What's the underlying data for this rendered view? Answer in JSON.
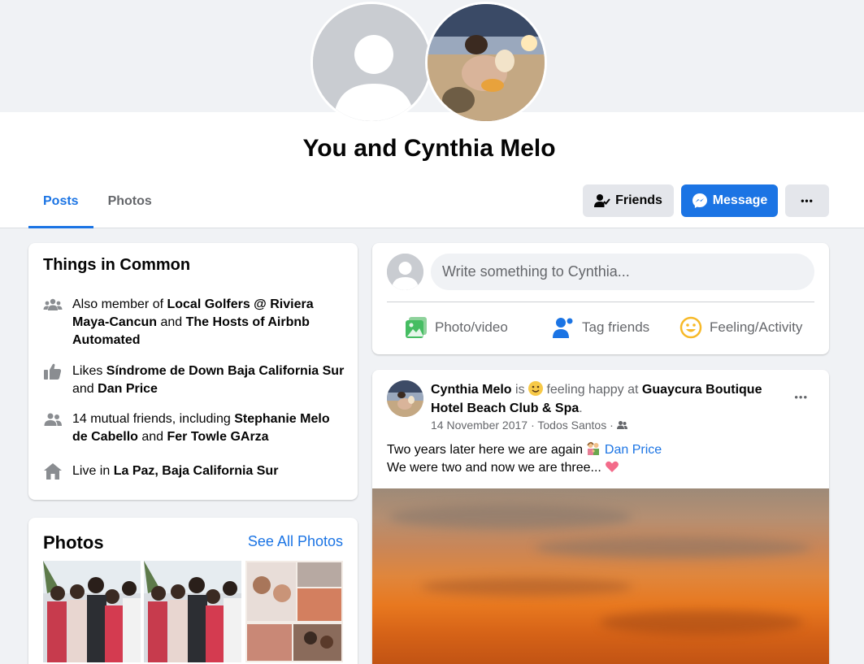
{
  "profile": {
    "title": "You and Cynthia Melo"
  },
  "tabs": [
    {
      "label": "Posts",
      "active": true
    },
    {
      "label": "Photos",
      "active": false
    }
  ],
  "actions": {
    "friends_label": "Friends",
    "message_label": "Message",
    "more_label": "•••"
  },
  "things_in_common": {
    "title": "Things in Common",
    "items": [
      {
        "icon": "groups-icon",
        "prefix": "Also member of ",
        "bold1": "Local Golfers @ Riviera Maya-Cancun",
        "mid": " and ",
        "bold2": "The Hosts of Airbnb Automated"
      },
      {
        "icon": "like-icon",
        "prefix": "Likes ",
        "bold1": "Síndrome de Down Baja California Sur",
        "mid": " and ",
        "bold2": "Dan Price"
      },
      {
        "icon": "friends-icon",
        "prefix": "14 mutual friends, including ",
        "bold1": "Stephanie Melo de Cabello",
        "mid": " and ",
        "bold2": "Fer Towle GArza"
      },
      {
        "icon": "home-icon",
        "prefix": "Live in ",
        "bold1": "La Paz, Baja California Sur",
        "mid": "",
        "bold2": ""
      }
    ]
  },
  "photos": {
    "title": "Photos",
    "see_all": "See All Photos"
  },
  "composer": {
    "placeholder": "Write something to Cynthia...",
    "photo_video": "Photo/video",
    "tag_friends": "Tag friends",
    "feeling": "Feeling/Activity"
  },
  "post": {
    "author": "Cynthia Melo",
    "is": " is ",
    "feeling": " feeling happy at ",
    "place": "Guaycura Boutique Hotel Beach Club & Spa",
    "period": ".",
    "date": "14 November 2017",
    "location": " · Todos Santos · ",
    "line1": "Two years later here we are again ",
    "mention": "Dan Price",
    "line2": "We were two and now we are three... ",
    "more": "•••"
  },
  "colors": {
    "accent": "#1b74e4",
    "background": "#f0f2f5",
    "secondary_text": "#65676b"
  }
}
